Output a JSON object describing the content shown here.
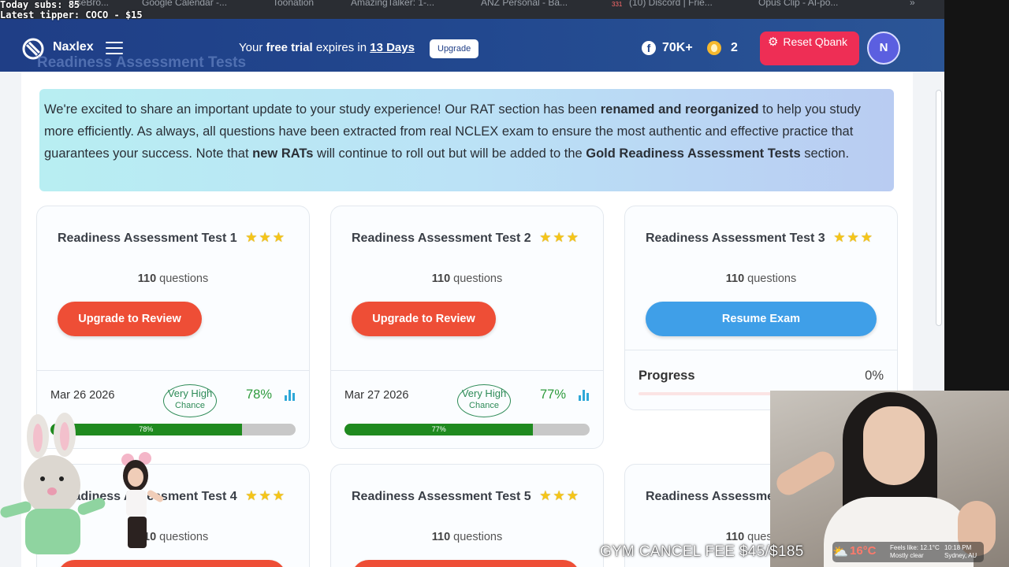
{
  "stream": {
    "subs_label": "Today subs: 85",
    "tipper_label": "Latest tipper: COCO - $15",
    "gym_fee": "GYM CANCEL FEE $45/$185",
    "weather": {
      "temp": "16°C",
      "feels_like": "Feels like: 12.1°C",
      "condition": "Mostly clear",
      "time": "10:18 PM",
      "location": "Sydney, AU"
    }
  },
  "bookmarks": [
    {
      "label": "wseBro..."
    },
    {
      "label": "Google Calendar -..."
    },
    {
      "label": "Toonation"
    },
    {
      "label": "AmazingTalker: 1-..."
    },
    {
      "label": "ANZ Personal - Ba..."
    },
    {
      "label": "(10) Discord | Frie..."
    },
    {
      "label": "Opus Clip - AI-po..."
    }
  ],
  "bookmark_badge": "331",
  "header": {
    "brand": "Naxlex",
    "page_title": "Readiness Assessment Tests",
    "trial_prefix": "Your",
    "trial_bold": "free trial",
    "trial_mid": "expires in",
    "trial_days": "13 Days",
    "upgrade_label": "Upgrade",
    "fb_count": "70K+",
    "streak_count": "2",
    "reset_label": "Reset Qbank",
    "avatar_initial": "N"
  },
  "notice": {
    "p1": "We're excited to share an important update to your study experience! Our RAT section has been ",
    "b1": "renamed and reorganized",
    "p2": " to help you study more efficiently. As always, all questions have been extracted from real NCLEX exam to ensure the most authentic and effective practice that guarantees your success. Note that ",
    "b2": "new RATs",
    "p3": " will continue to roll out but will be added to the ",
    "b3": "Gold Readiness Assessment Tests",
    "p4": " section."
  },
  "cards": [
    {
      "title": "Readiness Assessment Test 1",
      "questions": "110",
      "questions_suffix": "questions",
      "action": "Upgrade to Review",
      "date": "Mar 26 2026",
      "chance_l1": "Very High",
      "chance_l2": "Chance",
      "percent": "78%",
      "bar_label": "78%",
      "fill": 0.78
    },
    {
      "title": "Readiness Assessment Test 2",
      "questions": "110",
      "questions_suffix": "questions",
      "action": "Upgrade to Review",
      "date": "Mar 27 2026",
      "chance_l1": "Very High",
      "chance_l2": "Chance",
      "percent": "77%",
      "bar_label": "77%",
      "fill": 0.77
    },
    {
      "title": "Readiness Assessment Test 3",
      "questions": "110",
      "questions_suffix": "questions",
      "action": "Resume Exam",
      "progress_label": "Progress",
      "progress_value": "0%",
      "fill": 0
    },
    {
      "title": "Readiness Assessment Test 4",
      "questions": "110",
      "questions_suffix": "questions"
    },
    {
      "title": "Readiness Assessment Test 5",
      "questions": "110",
      "questions_suffix": "questions"
    },
    {
      "title": "Readiness Assessment Test 6",
      "questions": "110",
      "questions_suffix": "questions"
    }
  ],
  "colors": {
    "topbar": "#22488f",
    "upgrade_button": "#ee4e36",
    "resume_button": "#3f9fe8",
    "reset_button": "#ee2e55",
    "progress_fill": "#1f8a1f",
    "chance_green": "#2e8b57",
    "star": "#f5c518"
  },
  "icons": {
    "logo": "naxlex-logo-icon",
    "menu": "hamburger-menu-icon",
    "facebook": "facebook-icon",
    "streak": "flame-icon",
    "reset": "gear-icon",
    "stars": "star-icon",
    "stats": "bar-chart-icon"
  }
}
